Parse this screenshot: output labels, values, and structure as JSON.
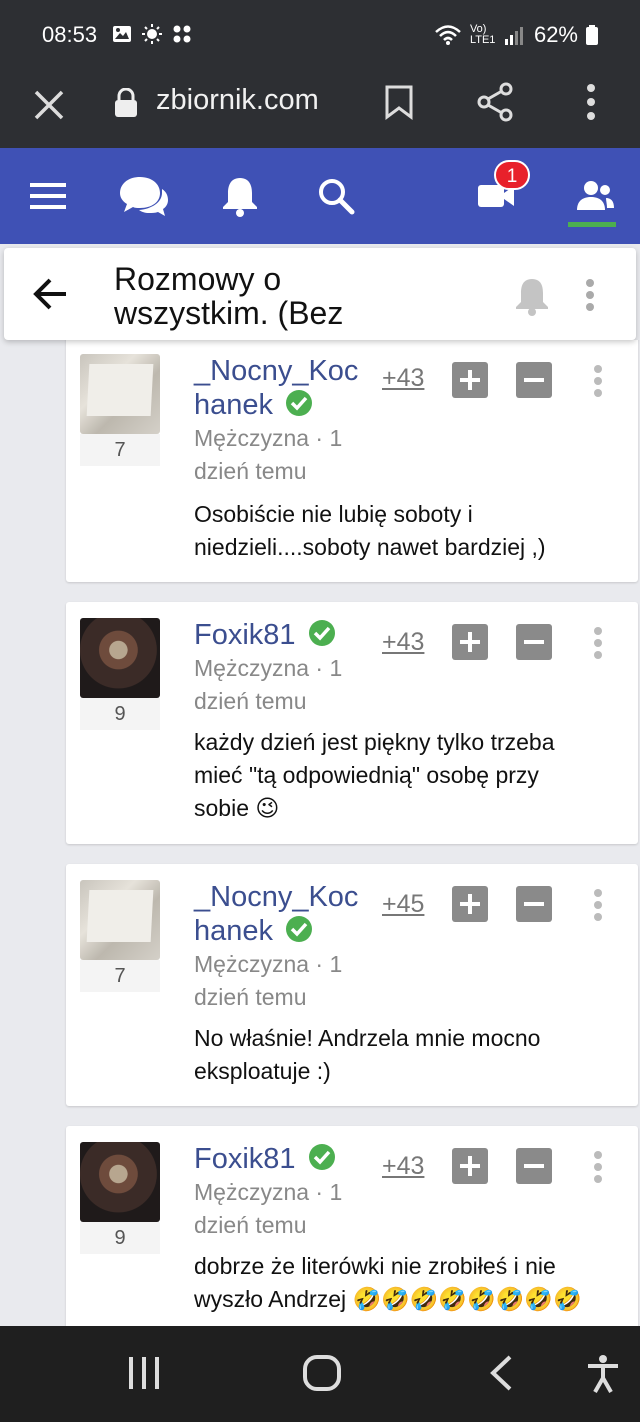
{
  "status": {
    "time": "08:53",
    "network": "Vo) LTE1",
    "battery": "62%"
  },
  "browser": {
    "url": "zbiornik.com"
  },
  "nav": {
    "video_badge": "1",
    "colors": {
      "bar": "#3f51b5",
      "active_underline": "#4caf50",
      "badge": "#e8212b"
    }
  },
  "thread": {
    "title": "Rozmowy o wszystkim. (Bez"
  },
  "comments": [
    {
      "author": "_Nocny_Kochanek",
      "author_line1": "_Nocny_Koc",
      "author_line2": "hanek",
      "avatar_count": "7",
      "meta_line1": "Mężczyzna · 1",
      "meta_line2": "dzień temu",
      "score": "+43",
      "text_line1": "Osobiście nie lubię soboty i",
      "text_line2": "niedzieli....soboty nawet bardziej ,)",
      "text_line3": ""
    },
    {
      "author": "Foxik81",
      "author_line1": "Foxik81",
      "author_line2": "",
      "avatar_count": "9",
      "meta_line1": "Mężczyzna · 1",
      "meta_line2": "dzień temu",
      "score": "+43",
      "text_line1": "każdy dzień jest piękny tylko trzeba",
      "text_line2": "mieć \"tą odpowiednią\" osobę przy",
      "text_line3": "sobie 😉"
    },
    {
      "author": "_Nocny_Kochanek",
      "author_line1": "_Nocny_Koc",
      "author_line2": "hanek",
      "avatar_count": "7",
      "meta_line1": "Mężczyzna · 1",
      "meta_line2": "dzień temu",
      "score": "+45",
      "text_line1": "No właśnie! Andrzela mnie mocno",
      "text_line2": "eksploatuje :)",
      "text_line3": ""
    },
    {
      "author": "Foxik81",
      "author_line1": "Foxik81",
      "author_line2": "",
      "avatar_count": "9",
      "meta_line1": "Mężczyzna · 1",
      "meta_line2": "dzień temu",
      "score": "+43",
      "text_line1": "dobrze że literówki nie zrobiłeś i nie",
      "text_line2": "wyszło Andrzej 🤣🤣🤣🤣🤣🤣🤣🤣",
      "text_line3": ""
    }
  ]
}
